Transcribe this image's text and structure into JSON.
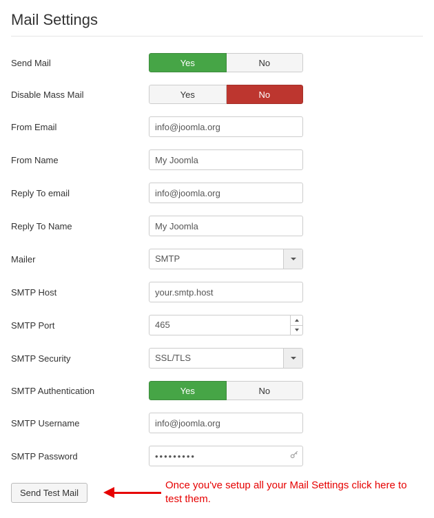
{
  "title": "Mail Settings",
  "fields": {
    "send_mail": {
      "label": "Send Mail",
      "yes": "Yes",
      "no": "No"
    },
    "disable_mass": {
      "label": "Disable Mass Mail",
      "yes": "Yes",
      "no": "No"
    },
    "from_email": {
      "label": "From Email",
      "value": "info@joomla.org"
    },
    "from_name": {
      "label": "From Name",
      "value": "My Joomla"
    },
    "reply_email": {
      "label": "Reply To email",
      "value": "info@joomla.org"
    },
    "reply_name": {
      "label": "Reply To Name",
      "value": "My Joomla"
    },
    "mailer": {
      "label": "Mailer",
      "value": "SMTP"
    },
    "smtp_host": {
      "label": "SMTP Host",
      "value": "your.smtp.host"
    },
    "smtp_port": {
      "label": "SMTP Port",
      "value": "465"
    },
    "smtp_security": {
      "label": "SMTP Security",
      "value": "SSL/TLS"
    },
    "smtp_auth": {
      "label": "SMTP Authentication",
      "yes": "Yes",
      "no": "No"
    },
    "smtp_user": {
      "label": "SMTP Username",
      "value": "info@joomla.org"
    },
    "smtp_pass": {
      "label": "SMTP Password",
      "value": "•••••••••"
    }
  },
  "button": {
    "send_test": "Send Test Mail"
  },
  "note": "Once you've setup all your Mail Settings click here to test them."
}
